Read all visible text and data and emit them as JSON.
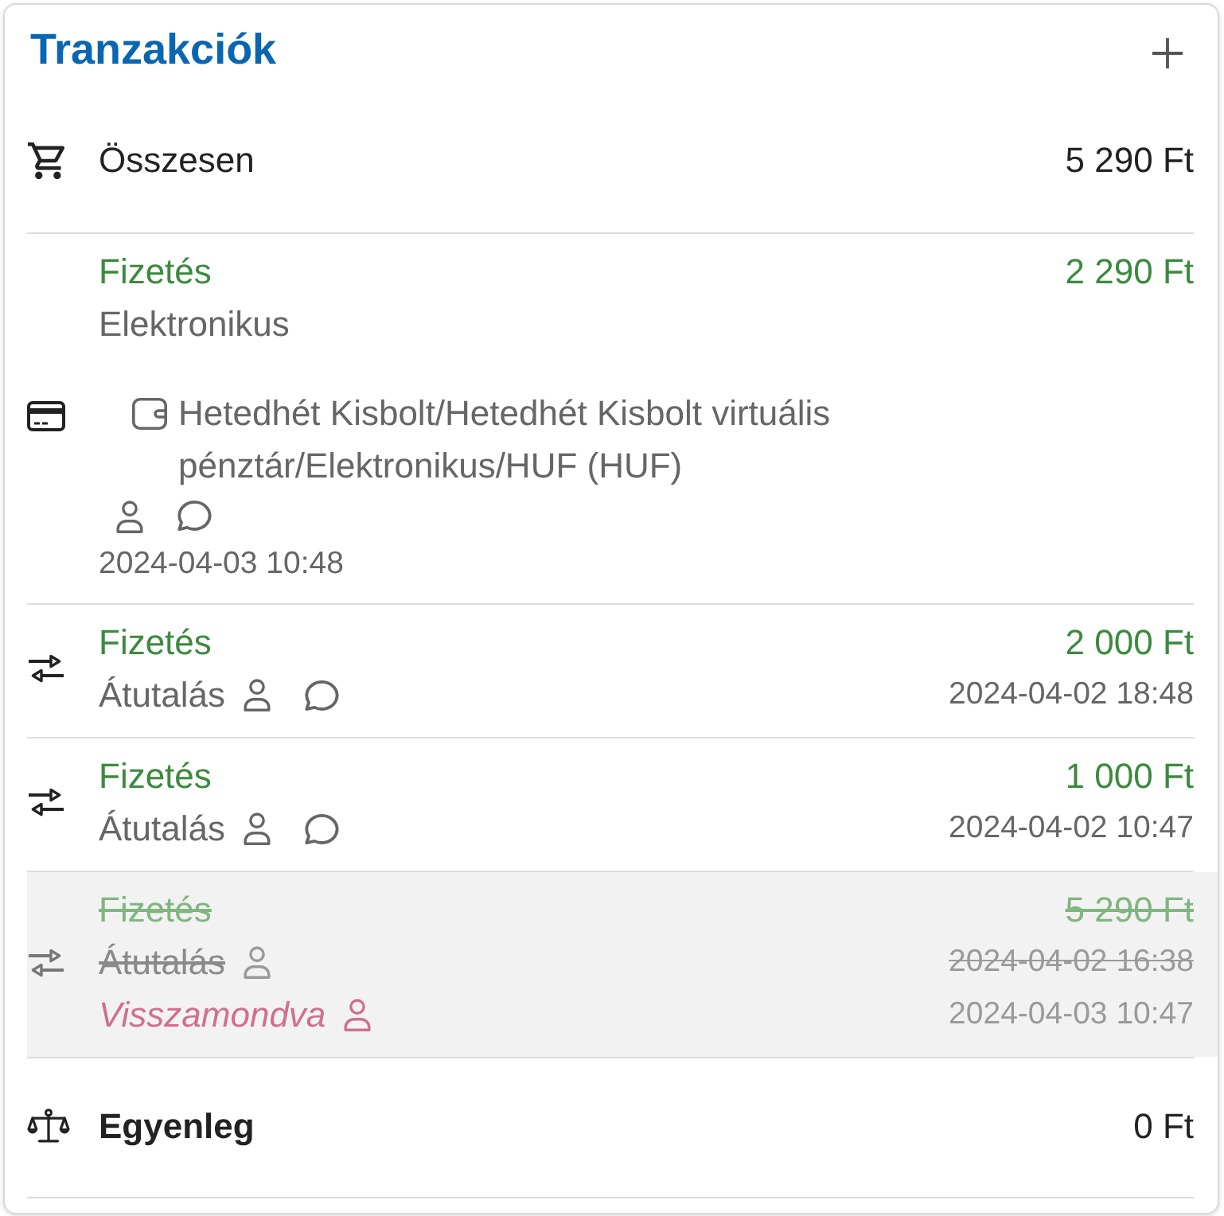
{
  "title": "Tranzakciók",
  "total": {
    "label": "Összesen",
    "amount": "5 290 Ft"
  },
  "payments": [
    {
      "kind": "card",
      "label": "Fizetés",
      "amount": "2 290 Ft",
      "method": "Elektronikus",
      "account": "Hetedhét Kisbolt/Hetedhét Kisbolt virtuális pénztár/Elektronikus/HUF (HUF)",
      "user": true,
      "comment": true,
      "date": "2024-04-03 10:48",
      "cancelled": false
    },
    {
      "kind": "transfer",
      "label": "Fizetés",
      "amount": "2 000 Ft",
      "method": "Átutalás",
      "user": true,
      "comment": true,
      "date": "2024-04-02 18:48",
      "cancelled": false
    },
    {
      "kind": "transfer",
      "label": "Fizetés",
      "amount": "1 000 Ft",
      "method": "Átutalás",
      "user": true,
      "comment": true,
      "date": "2024-04-02 10:47",
      "cancelled": false
    },
    {
      "kind": "transfer",
      "label": "Fizetés",
      "amount": "5 290 Ft",
      "method": "Átutalás",
      "user": true,
      "comment": false,
      "date": "2024-04-02 16:38",
      "cancelled": true,
      "cancellation": {
        "label": "Visszamondva",
        "user": true,
        "date": "2024-04-03 10:47"
      }
    }
  ],
  "balance": {
    "label": "Egyenleg",
    "amount": "0 Ft"
  }
}
